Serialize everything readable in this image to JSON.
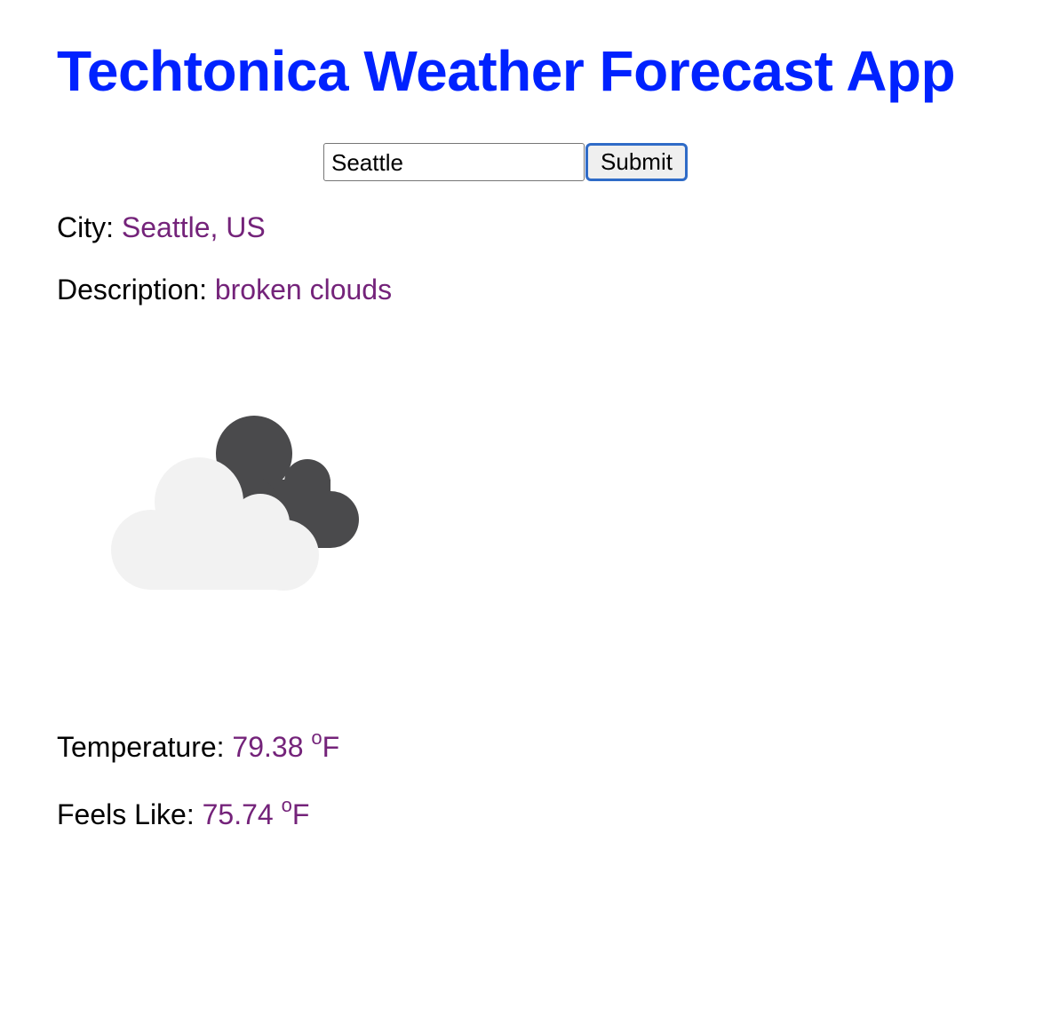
{
  "header": {
    "title": "Techtonica Weather Forecast App"
  },
  "search": {
    "value": "Seattle",
    "submit_label": "Submit"
  },
  "weather": {
    "city_label": "City: ",
    "city_value": "Seattle, US",
    "description_label": "Description: ",
    "description_value": "broken clouds",
    "icon": "broken-clouds-icon",
    "temperature_label": "Temperature: ",
    "temperature_value": "79.38",
    "temperature_unit_degree": "o",
    "temperature_unit": "F",
    "feels_like_label": "Feels Like: ",
    "feels_like_value": "75.74",
    "feels_like_unit_degree": "o",
    "feels_like_unit": "F"
  },
  "colors": {
    "title": "#0022ff",
    "value": "#74237a",
    "button_border": "#2f6bc7",
    "cloud_light": "#f2f2f2",
    "cloud_dark": "#4a4a4c"
  }
}
